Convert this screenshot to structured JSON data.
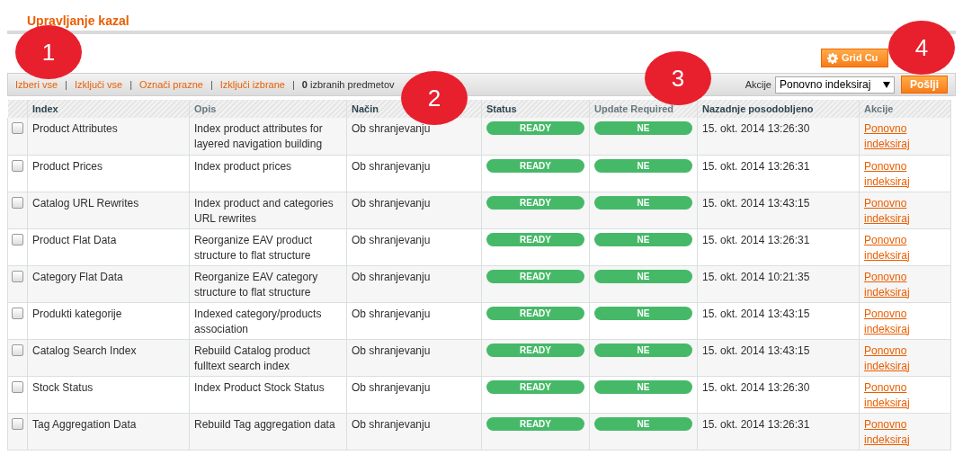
{
  "title": "Upravljanje kazal",
  "grid_button": {
    "label": "Grid Cu"
  },
  "massaction": {
    "separator": "|",
    "links": [
      "Izberi vse",
      "Izključi vse",
      "Označi prazne",
      "Izključi izbrane"
    ],
    "count": "0",
    "count_label": "izbranih predmetov",
    "actions_label": "Akcije",
    "select_value": "Ponovno indeksiraj",
    "submit": "Pošlji"
  },
  "table": {
    "columns": [
      {
        "label": "Index",
        "sortable": false
      },
      {
        "label": "Opis",
        "sortable": true
      },
      {
        "label": "Način",
        "sortable": false
      },
      {
        "label": "Status",
        "sortable": false
      },
      {
        "label": "Update Required",
        "sortable": true
      },
      {
        "label": "Nazadnje posodobljeno",
        "sortable": false
      },
      {
        "label": "Akcije",
        "sortable": true
      }
    ],
    "rows": [
      {
        "checked": false,
        "index": "Product Attributes",
        "opis": "Index product attributes for layered navigation building",
        "nacin": "Ob shranjevanju",
        "status": "READY",
        "update": "NE",
        "updated": "15. okt. 2014 13:26:30",
        "action": "Ponovno indeksiraj"
      },
      {
        "checked": false,
        "index": "Product Prices",
        "opis": "Index product prices",
        "nacin": "Ob shranjevanju",
        "status": "READY",
        "update": "NE",
        "updated": "15. okt. 2014 13:26:31",
        "action": "Ponovno indeksiraj"
      },
      {
        "checked": false,
        "index": "Catalog URL Rewrites",
        "opis": "Index product and categories URL rewrites",
        "nacin": "Ob shranjevanju",
        "status": "READY",
        "update": "NE",
        "updated": "15. okt. 2014 13:43:15",
        "action": "Ponovno indeksiraj"
      },
      {
        "checked": false,
        "index": "Product Flat Data",
        "opis": "Reorganize EAV product structure to flat structure",
        "nacin": "Ob shranjevanju",
        "status": "READY",
        "update": "NE",
        "updated": "15. okt. 2014 13:26:31",
        "action": "Ponovno indeksiraj"
      },
      {
        "checked": false,
        "index": "Category Flat Data",
        "opis": "Reorganize EAV category structure to flat structure",
        "nacin": "Ob shranjevanju",
        "status": "READY",
        "update": "NE",
        "updated": "15. okt. 2014 10:21:35",
        "action": "Ponovno indeksiraj"
      },
      {
        "checked": false,
        "index": "Produkti kategorije",
        "opis": "Indexed category/products association",
        "nacin": "Ob shranjevanju",
        "status": "READY",
        "update": "NE",
        "updated": "15. okt. 2014 13:43:15",
        "action": "Ponovno indeksiraj"
      },
      {
        "checked": false,
        "index": "Catalog Search Index",
        "opis": "Rebuild Catalog product fulltext search index",
        "nacin": "Ob shranjevanju",
        "status": "READY",
        "update": "NE",
        "updated": "15. okt. 2014 13:43:15",
        "action": "Ponovno indeksiraj"
      },
      {
        "checked": false,
        "index": "Stock Status",
        "opis": "Index Product Stock Status",
        "nacin": "Ob shranjevanju",
        "status": "READY",
        "update": "NE",
        "updated": "15. okt. 2014 13:26:30",
        "action": "Ponovno indeksiraj"
      },
      {
        "checked": false,
        "index": "Tag Aggregation Data",
        "opis": "Rebuild Tag aggregation data",
        "nacin": "Ob shranjevanju",
        "status": "READY",
        "update": "NE",
        "updated": "15. okt. 2014 13:26:31",
        "action": "Ponovno indeksiraj"
      }
    ]
  },
  "callouts": [
    "1",
    "2",
    "3",
    "4"
  ]
}
